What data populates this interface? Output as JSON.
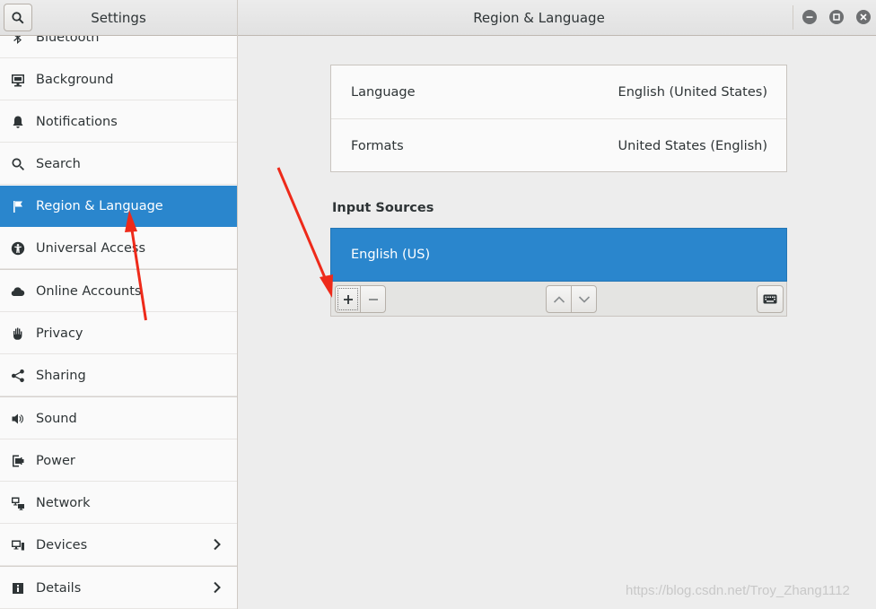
{
  "header": {
    "left_title": "Settings",
    "right_title": "Region & Language",
    "window_controls": [
      "minimize",
      "maximize",
      "close"
    ]
  },
  "sidebar": {
    "items": [
      {
        "label": "Bluetooth",
        "icon": "bluetooth-icon"
      },
      {
        "label": "Background",
        "icon": "background-icon"
      },
      {
        "label": "Notifications",
        "icon": "bell-icon"
      },
      {
        "label": "Search",
        "icon": "search-icon"
      },
      {
        "label": "Region & Language",
        "icon": "flag-icon",
        "selected": true
      },
      {
        "label": "Universal Access",
        "icon": "accessibility-icon"
      },
      {
        "label": "Online Accounts",
        "icon": "cloud-icon"
      },
      {
        "label": "Privacy",
        "icon": "hand-icon"
      },
      {
        "label": "Sharing",
        "icon": "share-icon"
      },
      {
        "label": "Sound",
        "icon": "speaker-icon"
      },
      {
        "label": "Power",
        "icon": "power-icon"
      },
      {
        "label": "Network",
        "icon": "network-icon"
      },
      {
        "label": "Devices",
        "icon": "devices-icon",
        "has_submenu": true
      },
      {
        "label": "Details",
        "icon": "info-icon",
        "has_submenu": true
      }
    ]
  },
  "main": {
    "language": {
      "label": "Language",
      "value": "English (United States)"
    },
    "formats": {
      "label": "Formats",
      "value": "United States (English)"
    },
    "input_sources": {
      "title": "Input Sources",
      "items": [
        "English (US)"
      ],
      "selected": "English (US)"
    }
  },
  "annotations": {
    "arrow_color": "#ee2a1a"
  },
  "watermark": "https://blog.csdn.net/Troy_Zhang1112",
  "colors": {
    "accent": "#2a86cd",
    "sidebar_bg": "#fafafa",
    "main_bg": "#ededed"
  }
}
